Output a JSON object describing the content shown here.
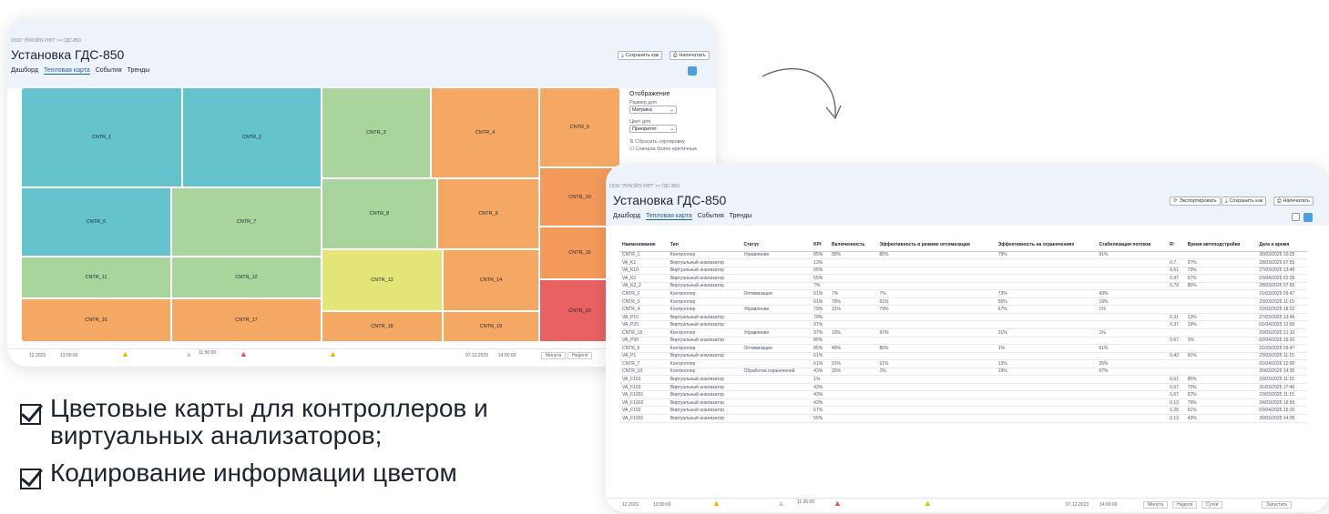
{
  "breadcrumb": "ООО \"ЛУКОЙЛ-УНП\" >> ГДС-850",
  "page_title": "Установка ГДС-850",
  "tabs": [
    "Дашборд",
    "Тепловая карта",
    "События",
    "Тренды"
  ],
  "heatmap_window": {
    "buttons": {
      "save": "Сохранить как",
      "print": "Напечатать"
    },
    "tiles": [
      "CNTR_1",
      "CNTR_2",
      "CNTR_3",
      "CNTR_4",
      "CNTR_5",
      "CNTR_6",
      "CNTR_7",
      "CNTR_8",
      "CNTR_9",
      "CNTR_10",
      "CNTR_11",
      "CNTR_12",
      "CNTR_13",
      "CNTR_14",
      "CNTR_15",
      "CNTR_16",
      "CNTR_17",
      "CNTR_18",
      "CNTR_19",
      "CNTR_20"
    ],
    "panel": {
      "title": "Отображение",
      "size_label": "Размер для",
      "size_value": "Метрика",
      "color_label": "Цвет для",
      "color_value": "Приоритет",
      "reset": "Сбросить сортировку",
      "fill": "Сначала более критичные"
    },
    "timeline": {
      "start": "12.2023",
      "start_time": "13:00:00",
      "mid_time": "11:50:00",
      "end_date": "07.12.2023",
      "end_time": "14:00:00",
      "b1": "Минута",
      "b2": "Неделя"
    },
    "colors": {
      "teal": "#65c3cd",
      "green": "#a9d59c",
      "orange": "#f5a764",
      "yellow": "#e3e578",
      "red": "#e96262"
    }
  },
  "table_window": {
    "buttons": {
      "export": "Экспортировать",
      "save": "Сохранить как",
      "print": "Напечатать"
    },
    "columns": [
      "Наименование",
      "Тип",
      "Статус",
      "KPI",
      "Включенность",
      "Эффективность в режиме оптимизации",
      "Эффективность на ограничениях",
      "Стабилизация потоков",
      "R²",
      "Время автоподстройки",
      "Дата и время"
    ],
    "rows": [
      [
        "CNTR_1",
        "Контроллер",
        "Управление",
        "85%",
        "55%",
        "85%",
        "79%",
        "91%",
        "",
        "",
        "30/03/2025 10:25"
      ],
      [
        "VA_K1",
        "Виртуальный анализатор",
        "",
        "13%",
        "",
        "",
        "",
        "",
        "0,7",
        "37%",
        "28/03/2025 07:55"
      ],
      [
        "VA_K10",
        "Виртуальный анализатор",
        "",
        "55%",
        "",
        "",
        "",
        "",
        "0,61",
        "73%",
        "27/03/2025 13:40"
      ],
      [
        "VA_K2",
        "Виртуальный анализатор",
        "",
        "55%",
        "",
        "",
        "",
        "",
        "0,97",
        "67%",
        "03/04/2025 22:35"
      ],
      [
        "VA_K2_2",
        "Виртуальный анализатор",
        "",
        "7%",
        "",
        "",
        "",
        "",
        "0,79",
        "85%",
        "28/03/2025 07:55"
      ],
      [
        "CNTR_2",
        "Контроллер",
        "Оптимизация",
        "61%",
        "7%",
        "7%",
        "73%",
        "43%",
        "",
        "",
        "21/03/2025 09:47"
      ],
      [
        "CNTR_3",
        "Контроллер",
        "",
        "61%",
        "79%",
        "61%",
        "55%",
        "19%",
        "",
        "",
        "23/03/2025 11:15"
      ],
      [
        "CNTR_4",
        "Контроллер",
        "Управление",
        "79%",
        "31%",
        "79%",
        "67%",
        "1%",
        "",
        "",
        "22/03/2025 18:22"
      ],
      [
        "VA_P10",
        "Виртуальный анализатор",
        "",
        "79%",
        "",
        "",
        "",
        "",
        "0,31",
        "13%",
        "27/03/2025 13:45"
      ],
      [
        "VA_P20",
        "Виртуальный анализатор",
        "",
        "97%",
        "",
        "",
        "",
        "",
        "0,37",
        "19%",
        "01/04/2025 12:00"
      ],
      [
        "CNTR_15",
        "Контроллер",
        "Управление",
        "97%",
        "19%",
        "97%",
        "31%",
        "1%",
        "",
        "",
        "29/03/2025 21:10"
      ],
      [
        "VA_P30",
        "Виртуальный анализатор",
        "",
        "85%",
        "",
        "",
        "",
        "",
        "0,67",
        "1%",
        "02/04/2025 15:20"
      ],
      [
        "CNTR_6",
        "Контроллер",
        "Оптимизация",
        "85%",
        "49%",
        "85%",
        "1%",
        "61%",
        "",
        "",
        "21/03/2025 09:47"
      ],
      [
        "VA_P1",
        "Виртуальный анализатор",
        "",
        "61%",
        "",
        "",
        "",
        "",
        "0,43",
        "91%",
        "23/03/2025 11:15"
      ],
      [
        "CNTR_7",
        "Контроллер",
        "",
        "61%",
        "91%",
        "61%",
        "13%",
        "25%",
        "",
        "",
        "01/04/2025 12:00"
      ],
      [
        "CNTR_10",
        "Контроллер",
        "Обработка ограничений",
        "43%",
        "25%",
        "1%",
        "19%",
        "67%",
        "",
        "",
        "20/03/2025 14:35"
      ],
      [
        "VA_F101",
        "Виртуальный анализатор",
        "",
        "1%",
        "",
        "",
        "",
        "",
        "0,61",
        "85%",
        "23/03/2025 11:15"
      ],
      [
        "VA_F102",
        "Виртуальный анализатор",
        "",
        "43%",
        "",
        "",
        "",
        "",
        "0,67",
        "73%",
        "31/03/2025 17:40"
      ],
      [
        "VA_F1001",
        "Виртуальный анализатор",
        "",
        "43%",
        "",
        "",
        "",
        "",
        "0,67",
        "97%",
        "23/03/2025 11:15"
      ],
      [
        "VA_F1002",
        "Виртуальный анализатор",
        "",
        "43%",
        "",
        "",
        "",
        "",
        "0,13",
        "79%",
        "24/03/2025 16:50"
      ],
      [
        "VA_F102",
        "Виртуальный анализатор",
        "",
        "67%",
        "",
        "",
        "",
        "",
        "0,25",
        "61%",
        "03/04/2025 15:20"
      ],
      [
        "VA_F1001",
        "Виртуальный анализатор",
        "",
        "55%",
        "",
        "",
        "",
        "",
        "0,13",
        "43%",
        "20/03/2025 14:35"
      ]
    ],
    "timeline": {
      "start": "12.2023",
      "start_time": "13:00:00",
      "mid_time": "11:30:00",
      "end_date": "07.12.2023",
      "end_time": "14:00:00",
      "b1": "Минута",
      "b2": "Неделя",
      "b3": "Сутки",
      "b4": "Запустить"
    }
  },
  "bullets": [
    "Цветовые карты для контроллеров и виртуальных анализаторов;",
    "Кодирование информации цветом"
  ]
}
